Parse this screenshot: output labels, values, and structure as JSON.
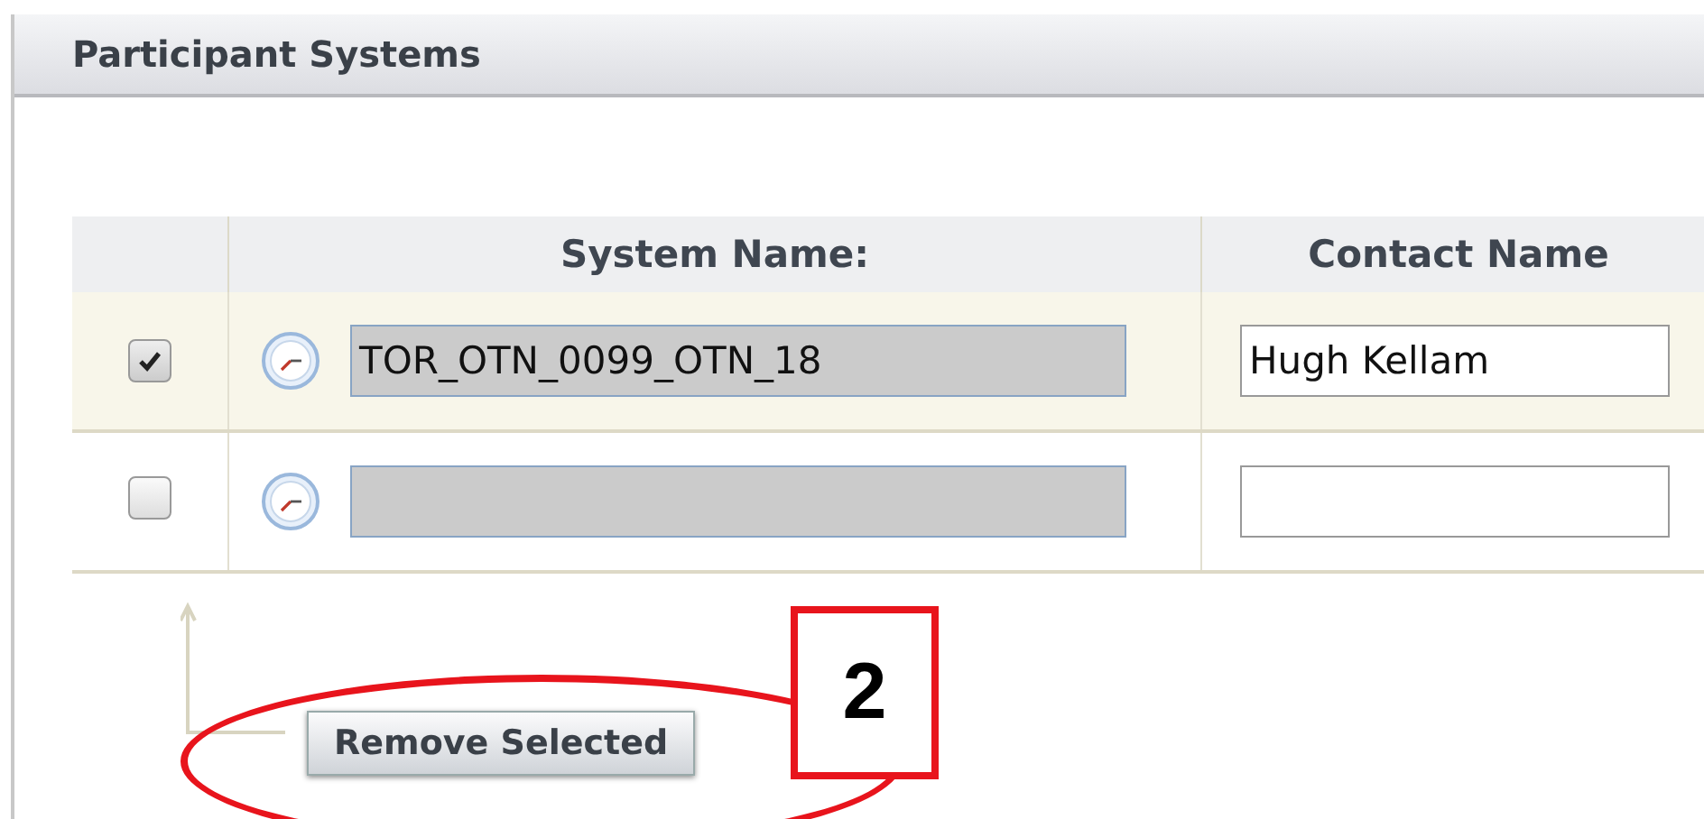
{
  "panel": {
    "title": "Participant Systems"
  },
  "table": {
    "columns": [
      "System Name:",
      "Contact Name"
    ],
    "rows": [
      {
        "selected": true,
        "system_name": "TOR_OTN_0099_OTN_18",
        "contact_name": "Hugh Kellam"
      },
      {
        "selected": false,
        "system_name": "",
        "contact_name": ""
      }
    ]
  },
  "button": {
    "label": "Remove Selected"
  },
  "callout": {
    "label": "2"
  }
}
